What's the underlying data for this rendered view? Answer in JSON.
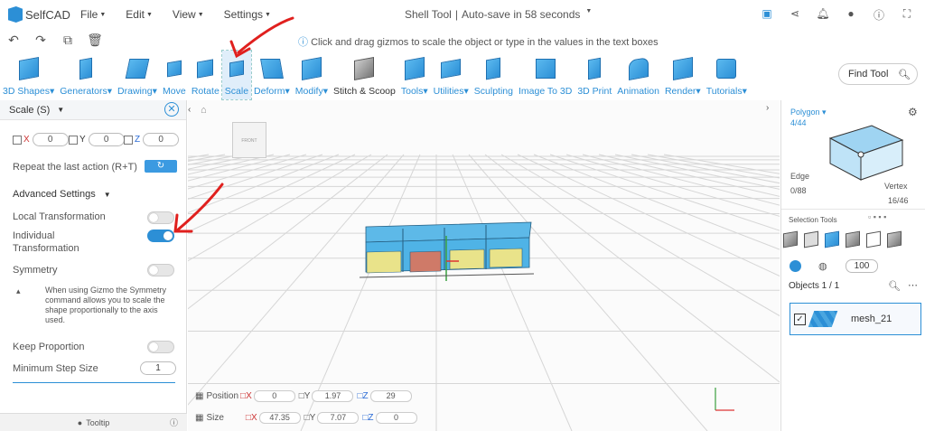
{
  "app": {
    "logo_text": "SelfCAD",
    "title": "Shell Tool",
    "autosave": "Auto-save in 58 seconds"
  },
  "menu": [
    "File",
    "Edit",
    "View",
    "Settings"
  ],
  "hint": "Click and drag gizmos to scale the object or type in the values in the text boxes",
  "toolbar": {
    "items": [
      {
        "label": "3D Shapes",
        "dropdown": true
      },
      {
        "label": "Generators",
        "dropdown": true
      },
      {
        "label": "Drawing",
        "dropdown": true
      },
      {
        "label": "Move",
        "dropdown": false
      },
      {
        "label": "Rotate",
        "dropdown": false
      },
      {
        "label": "Scale",
        "dropdown": false
      },
      {
        "label": "Deform",
        "dropdown": true
      },
      {
        "label": "Modify",
        "dropdown": true
      },
      {
        "label": "Stitch & Scoop",
        "dropdown": false
      },
      {
        "label": "Tools",
        "dropdown": true
      },
      {
        "label": "Utilities",
        "dropdown": true
      },
      {
        "label": "Sculpting",
        "dropdown": false
      },
      {
        "label": "Image To 3D",
        "dropdown": false
      },
      {
        "label": "3D Print",
        "dropdown": false
      },
      {
        "label": "Animation",
        "dropdown": false
      },
      {
        "label": "Render",
        "dropdown": true
      },
      {
        "label": "Tutorials",
        "dropdown": true
      }
    ],
    "find_placeholder": "Find Tool"
  },
  "left_panel": {
    "title": "Scale (S)",
    "x_value": "0",
    "y_value": "0",
    "z_value": "0",
    "repeat_label": "Repeat the last action (R+T)",
    "advanced": "Advanced Settings",
    "local_transformation": "Local Transformation",
    "individual_transformation_1": "Individual",
    "individual_transformation_2": "Transformation",
    "symmetry": "Symmetry",
    "symmetry_note": "When using Gizmo the Symmetry command allows you to scale the shape proportionally to the axis used.",
    "keep_proportion": "Keep Proportion",
    "min_step_label": "Minimum Step Size",
    "min_step_value": "1",
    "tooltip": "Tooltip"
  },
  "toggles": {
    "local_transformation": false,
    "individual_transformation": true,
    "symmetry": false,
    "keep_proportion": false
  },
  "viewport": {
    "cube_face": "FRONT",
    "position": {
      "label": "Position",
      "x": "0",
      "y": "1.97",
      "z": "29"
    },
    "size": {
      "label": "Size",
      "x": "47.35",
      "y": "7.07",
      "z": "0"
    }
  },
  "right_panel": {
    "polygon": "Polygon",
    "polygon_count": "4/44",
    "edge": "Edge",
    "edge_count": "0/88",
    "vertex": "Vertex",
    "vertex_count": "16/46",
    "selection_tools": "Selection Tools",
    "brush_value": "100",
    "objects": "Objects 1 / 1",
    "mesh_name": "mesh_21"
  },
  "colors": {
    "accent": "#2c8fd6",
    "annotation": "#e0201e",
    "box_blue": "#4fb3e6",
    "box_yellow": "#e9e38a",
    "box_selected": "#cf7a68"
  }
}
